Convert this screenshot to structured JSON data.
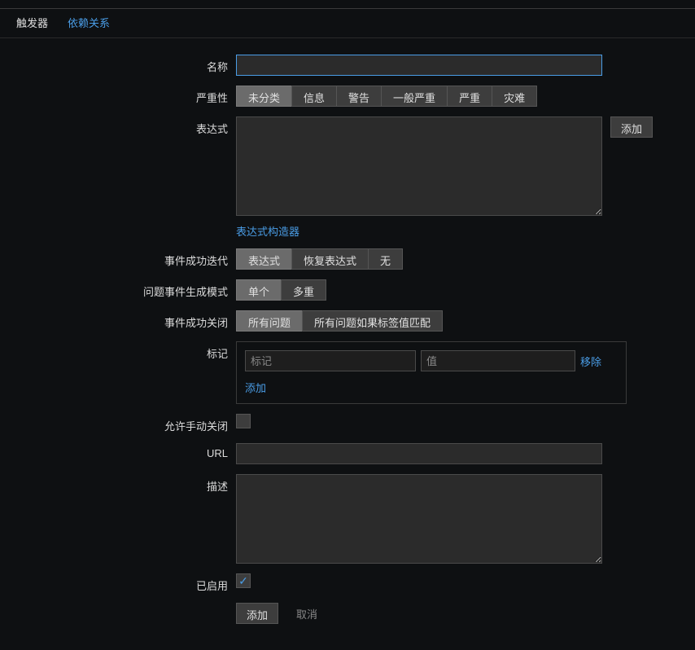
{
  "tabs": {
    "trigger": "触发器",
    "deps": "依赖关系"
  },
  "labels": {
    "name": "名称",
    "severity": "严重性",
    "expression": "表达式",
    "expr_builder": "表达式构造器",
    "ok_event_gen": "事件成功迭代",
    "problem_event_gen": "问题事件生成模式",
    "ok_event_close": "事件成功关闭",
    "tags": "标记",
    "allow_manual_close": "允许手动关闭",
    "url": "URL",
    "description": "描述",
    "enabled": "已启用"
  },
  "severity": {
    "not_classified": "未分类",
    "information": "信息",
    "warning": "警告",
    "average": "一般严重",
    "high": "严重",
    "disaster": "灾难"
  },
  "ok_event_gen": {
    "expression": "表达式",
    "recovery": "恢复表达式",
    "none": "无"
  },
  "problem_mode": {
    "single": "单个",
    "multiple": "多重"
  },
  "ok_close": {
    "all": "所有问题",
    "all_if_tag": "所有问题如果标签值匹配"
  },
  "tags": {
    "key_ph": "标记",
    "val_ph": "值",
    "remove": "移除",
    "add": "添加"
  },
  "buttons": {
    "add": "添加",
    "cancel": "取消",
    "side_add": "添加"
  },
  "values": {
    "name": "",
    "expression": "",
    "url": "",
    "description": "",
    "enabled": true,
    "allow_manual_close": false
  }
}
